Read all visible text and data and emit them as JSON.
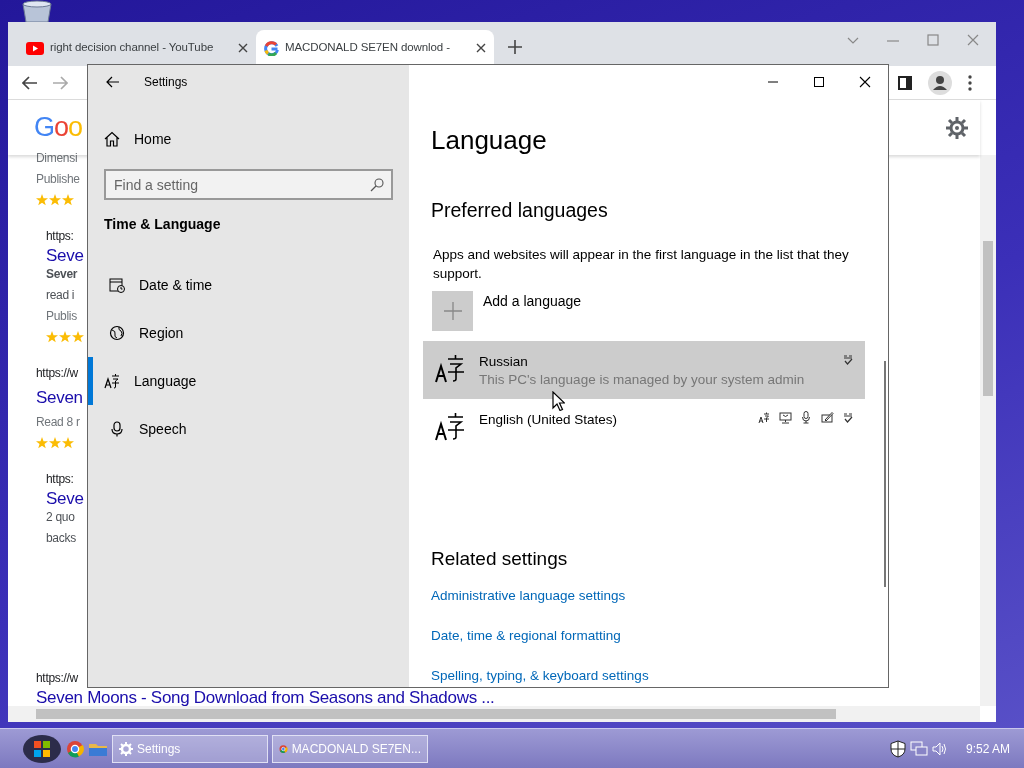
{
  "browser": {
    "tabs": [
      {
        "title": "right decision channel - YouTube",
        "kind": "youtube",
        "selected": false
      },
      {
        "title": "MACDONALD SE7EN downlod -",
        "kind": "google",
        "selected": true
      }
    ],
    "logo": "Goo",
    "results": [
      {
        "lines": [
          {
            "kind": "meta",
            "text": "Dimensi"
          },
          {
            "kind": "meta",
            "text": "Publishe"
          },
          {
            "kind": "stars",
            "stars": 3
          }
        ],
        "children": [
          {
            "lines": [
              {
                "kind": "url",
                "text": "https:"
              },
              {
                "kind": "title",
                "text": "Seve"
              },
              {
                "kind": "bold",
                "text": "Sever"
              },
              {
                "kind": "snippet",
                "text": "read i"
              },
              {
                "kind": "meta",
                "text": "Publis"
              },
              {
                "kind": "stars",
                "stars": 3
              }
            ]
          }
        ]
      },
      {
        "lines": [
          {
            "kind": "url",
            "text": "https://w"
          },
          {
            "kind": "title",
            "text": "Seven"
          },
          {
            "kind": "meta",
            "text": "Read 8 r"
          },
          {
            "kind": "stars",
            "stars": 3
          }
        ],
        "children": [
          {
            "lines": [
              {
                "kind": "url",
                "text": "https:"
              },
              {
                "kind": "title",
                "text": "Seve"
              },
              {
                "kind": "snippet",
                "text": "2 quo"
              },
              {
                "kind": "snippet",
                "text": "backs"
              }
            ]
          }
        ]
      },
      {
        "lines": [
          {
            "kind": "url",
            "text": "https://w"
          },
          {
            "kind": "title",
            "text": "Seven Moons - Song Download from Seasons and Shadows ..."
          }
        ]
      }
    ]
  },
  "settings": {
    "window_title": "Settings",
    "home": "Home",
    "search": {
      "placeholder": "Find a setting"
    },
    "section": "Time & Language",
    "nav": [
      {
        "label": "Date & time",
        "kind": "clock",
        "selected": false
      },
      {
        "label": "Region",
        "kind": "globe",
        "selected": false
      },
      {
        "label": "Language",
        "kind": "language",
        "selected": true
      },
      {
        "label": "Speech",
        "kind": "mic",
        "selected": false
      }
    ],
    "page_title": "Language",
    "preferred_heading": "Preferred languages",
    "description": "Apps and websites will appear in the first language in the list that they support.",
    "add_language": "Add a language",
    "languages": [
      {
        "name": "Russian",
        "note": "This PC's language is managed by your system admin",
        "selected": true,
        "kind": "managed"
      },
      {
        "name": "English (United States)",
        "selected": false,
        "kind": "installed"
      }
    ],
    "related_heading": "Related settings",
    "related_links": [
      "Administrative language settings",
      "Date, time & regional formatting",
      "Spelling, typing, & keyboard settings"
    ]
  },
  "taskbar": {
    "tasks": [
      {
        "label": "Settings",
        "kind": "settings"
      },
      {
        "label": "MACDONALD SE7EN...",
        "kind": "chrome"
      }
    ],
    "clock": "9:52 AM"
  }
}
